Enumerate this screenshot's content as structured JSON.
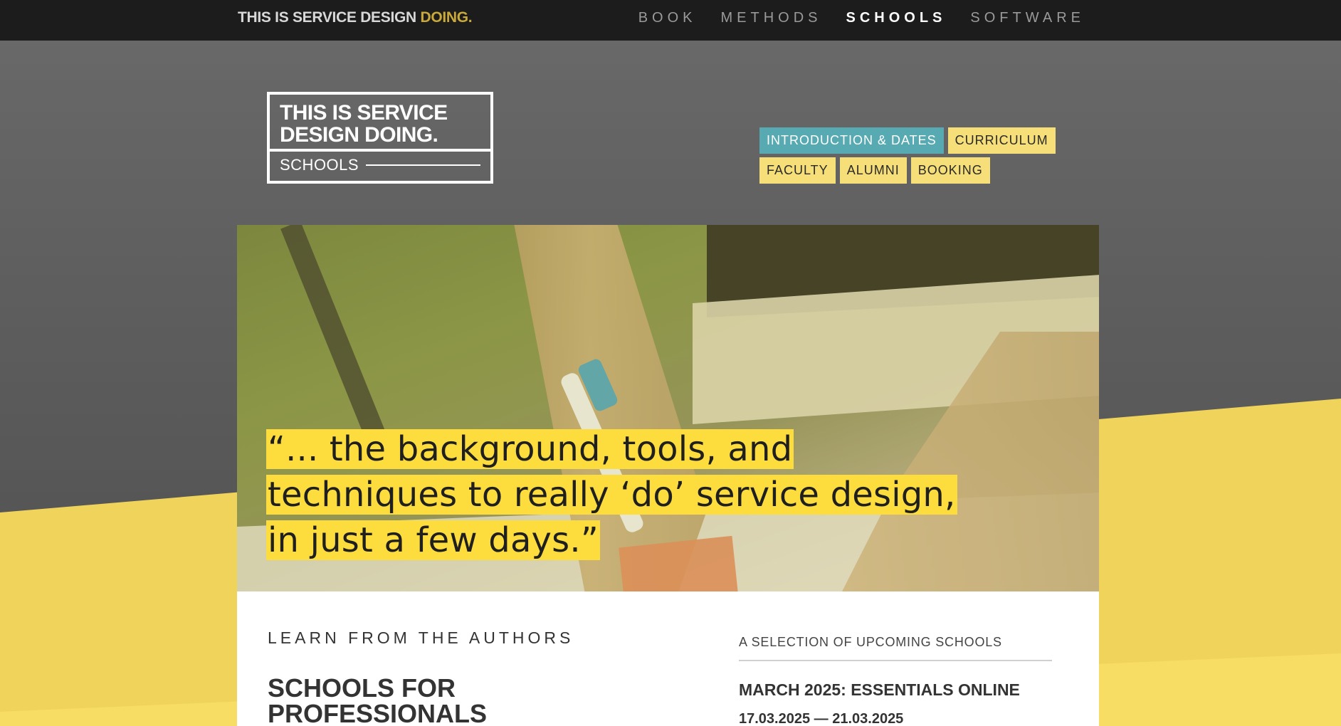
{
  "topbar": {
    "brand_main": "THIS IS SERVICE DESIGN",
    "brand_accent": "DOING.",
    "nav": [
      {
        "label": "BOOK",
        "active": false
      },
      {
        "label": "METHODS",
        "active": false
      },
      {
        "label": "SCHOOLS",
        "active": true
      },
      {
        "label": "SOFTWARE",
        "active": false
      }
    ]
  },
  "logo": {
    "line1": "THIS IS SERVICE",
    "line2": "DESIGN DOING.",
    "subtitle": "SCHOOLS"
  },
  "subnav": {
    "items": [
      {
        "label": "INTRODUCTION & DATES",
        "active": true
      },
      {
        "label": "CURRICULUM",
        "active": false
      },
      {
        "label": "FACULTY",
        "active": false
      },
      {
        "label": "ALUMNI",
        "active": false
      },
      {
        "label": "BOOKING",
        "active": false
      }
    ]
  },
  "hero": {
    "quote_line1": "“... the background, tools, and",
    "quote_line2": "techniques to really ‘do’ service design,",
    "quote_line3": "in just a few days.”"
  },
  "content": {
    "eyebrow": "LEARN FROM THE AUTHORS",
    "heading_line1": "SCHOOLS FOR",
    "heading_line2": "PROFESSIONALS",
    "upcoming_label": "A SELECTION OF UPCOMING SCHOOLS",
    "event_title": "MARCH 2025: ESSENTIALS ONLINE",
    "event_date": "17.03.2025 — 21.03.2025"
  },
  "colors": {
    "topbar_bg": "#1c1c1c",
    "brand_accent": "#c9a93a",
    "pill_yellow": "#f6df78",
    "pill_active_teal": "#57aab1",
    "quote_highlight": "#fddd3e",
    "page_yellow": "#f0d35a"
  }
}
